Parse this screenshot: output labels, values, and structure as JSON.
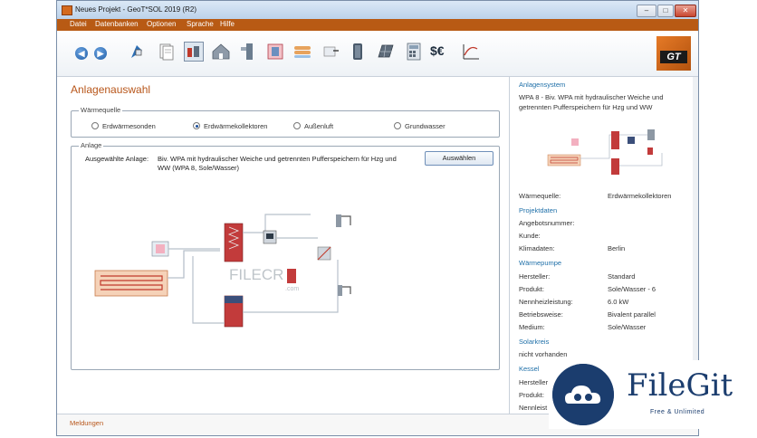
{
  "window": {
    "title": "Neues Projekt - GeoT*SOL 2019 (R2)",
    "controls": {
      "minimize": "–",
      "maximize": "□",
      "close": "✕"
    }
  },
  "menu": [
    "Datei",
    "Datenbanken",
    "Optionen",
    "Sprache",
    "Hilfe"
  ],
  "toolbar": {
    "icons": [
      "back-icon",
      "forward-icon",
      "location-icon",
      "documents-icon",
      "system-icon",
      "house-icon",
      "heat-pump-icon",
      "storage-icon",
      "radiator-icon",
      "water-tap-icon",
      "tank-icon",
      "solar-panel-icon",
      "calculator-icon",
      "currency-icon",
      "results-chart-icon"
    ],
    "back_label": "◀",
    "forward_label": "▶",
    "currency_label": "$€",
    "logo_text": "GT"
  },
  "main": {
    "page_title": "Anlagenauswahl",
    "heat_source": {
      "label": "Wärmequelle",
      "options": [
        "Erdwärmesonden",
        "Erdwärmekollektoren",
        "Außenluft",
        "Grundwasser"
      ],
      "selected": "Erdwärmekollektoren"
    },
    "system": {
      "label": "Anlage",
      "selected_label": "Ausgewählte Anlage:",
      "selected_value_line1": "Biv. WPA mit hydraulischer Weiche und getrennten Pufferspeichern für Hzg und",
      "selected_value_line2": "WW (WPA 8, Sole/Wasser)",
      "select_button": "Auswählen"
    },
    "diagram_watermark": "FILECR",
    "diagram_watermark_sub": ".com"
  },
  "sidebar": {
    "system_section": "Anlagensystem",
    "system_desc_line1": "WPA 8 - Biv. WPA mit hydraulischer Weiche und",
    "system_desc_line2": "getrennten Pufferspeichern für Hzg und WW",
    "heat_source_label": "Wärmequelle:",
    "heat_source_value": "Erdwärmekollektoren",
    "project_section": "Projektdaten",
    "offer_number_label": "Angebotsnummer:",
    "customer_label": "Kunde:",
    "climate_label": "Klimadaten:",
    "climate_value": "Berlin",
    "heatpump_section": "Wärmepumpe",
    "manufacturer_label": "Hersteller:",
    "manufacturer_value": "Standard",
    "product_label": "Produkt:",
    "product_value": "Sole/Wasser -  6",
    "rated_power_label": "Nennheizleistung:",
    "rated_power_value": "6.0 kW",
    "operation_label": "Betriebsweise:",
    "operation_value": "Bivalent parallel",
    "medium_label": "Medium:",
    "medium_value": "Sole/Wasser",
    "solar_section": "Solarkreis",
    "solar_value": "nicht vorhanden",
    "boiler_section": "Kessel",
    "boiler_manufacturer_label": "Hersteller",
    "boiler_product_label": "Produkt:",
    "boiler_rated_label": "Nennleist"
  },
  "status": {
    "messages": "Meldungen"
  },
  "watermark": {
    "brand": "FileGit",
    "tagline": "Free & Unlimited"
  }
}
